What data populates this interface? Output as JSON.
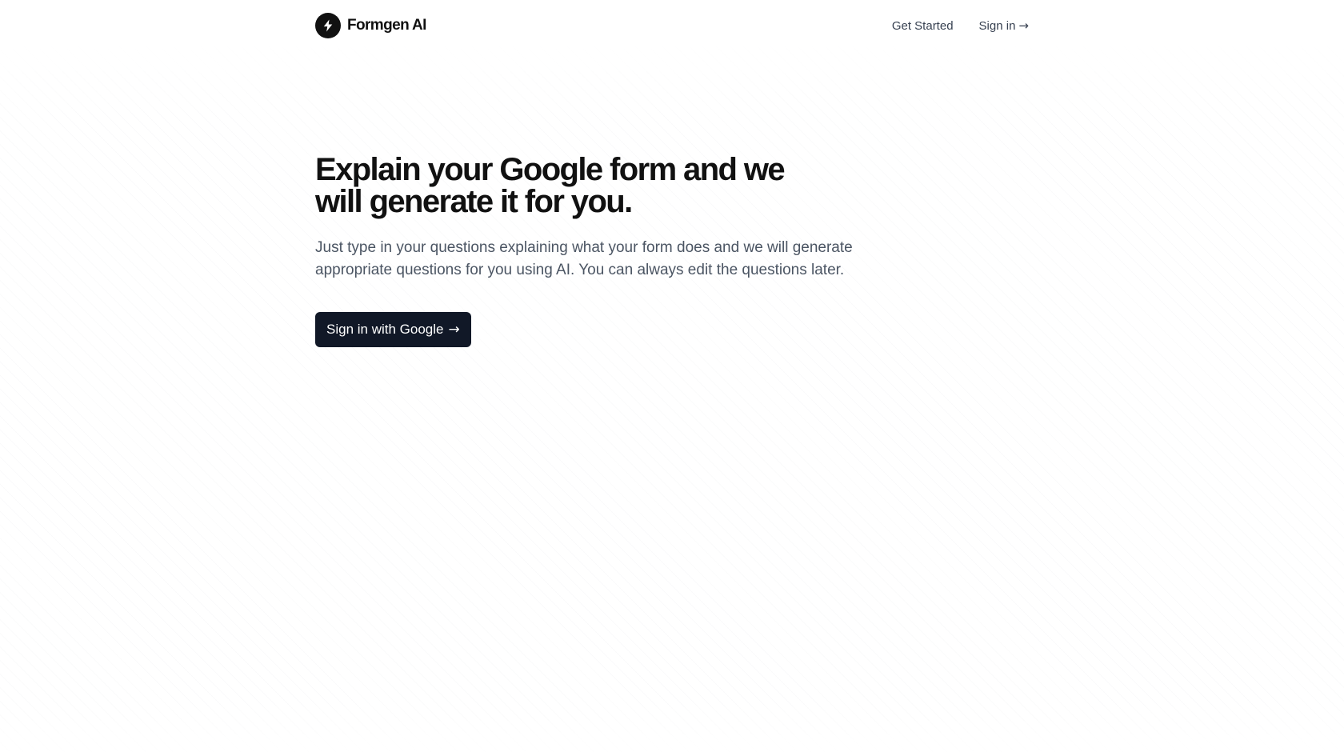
{
  "header": {
    "brand_name": "Formgen AI",
    "brand_icon": "lightning-bolt-icon",
    "nav": {
      "get_started": "Get Started",
      "sign_in": "Sign in",
      "sign_in_arrow": "→"
    }
  },
  "hero": {
    "title": "Explain your Google form and we will generate it for you.",
    "description": "Just type in your questions explaining what your form does and we will generate appropriate questions for you using AI. You can always edit the questions later.",
    "cta_label": "Sign in with Google",
    "cta_arrow": "→"
  },
  "colors": {
    "background": "#ffffff",
    "primary_text": "#111111",
    "button_bg": "#111827",
    "button_text": "#ffffff",
    "muted_text": "#4b5563"
  }
}
